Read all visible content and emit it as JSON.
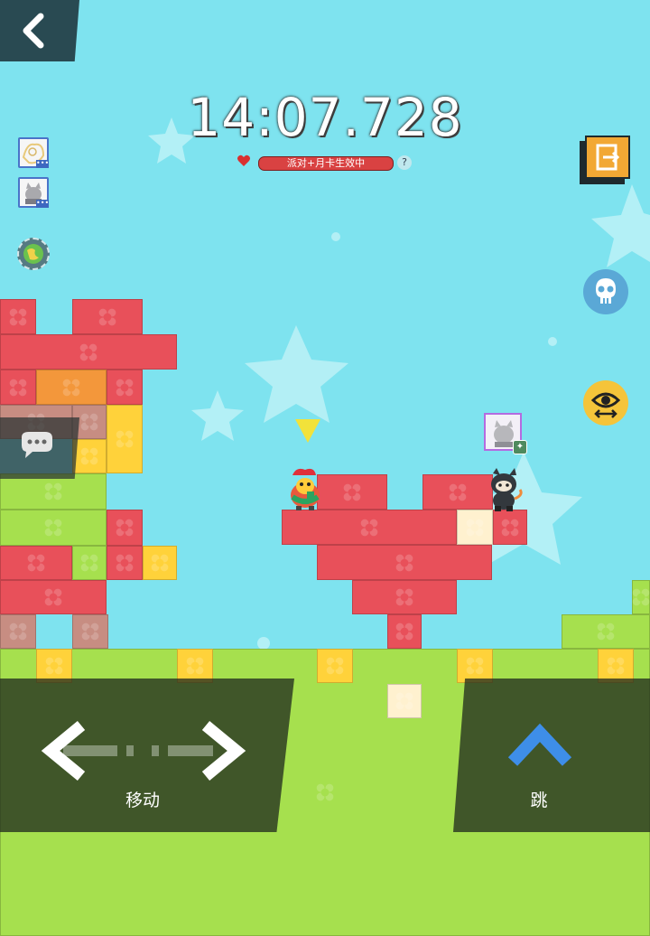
{
  "hud": {
    "timer": "14:07.728",
    "buff_text": "派对+月卡生效中",
    "help_mark": "?"
  },
  "controls": {
    "move_label": "移动",
    "jump_label": "跳"
  },
  "colors": {
    "sky": "#7ee3ef",
    "brick_red": "#e8505a",
    "brick_orange": "#f3973b",
    "brick_yellow": "#ffd23a",
    "brick_green": "#a6e04e",
    "brick_cream": "#fff1cf",
    "brick_pink": "#c78d82"
  },
  "icons": [
    "back-arrow-icon",
    "player-avatar-icon",
    "world-globe-icon",
    "exit-icon",
    "skull-icon",
    "eye-swap-icon",
    "chat-bubble-icon",
    "move-arrows-icon",
    "jump-arrow-icon",
    "heart-icon",
    "star-icon"
  ]
}
